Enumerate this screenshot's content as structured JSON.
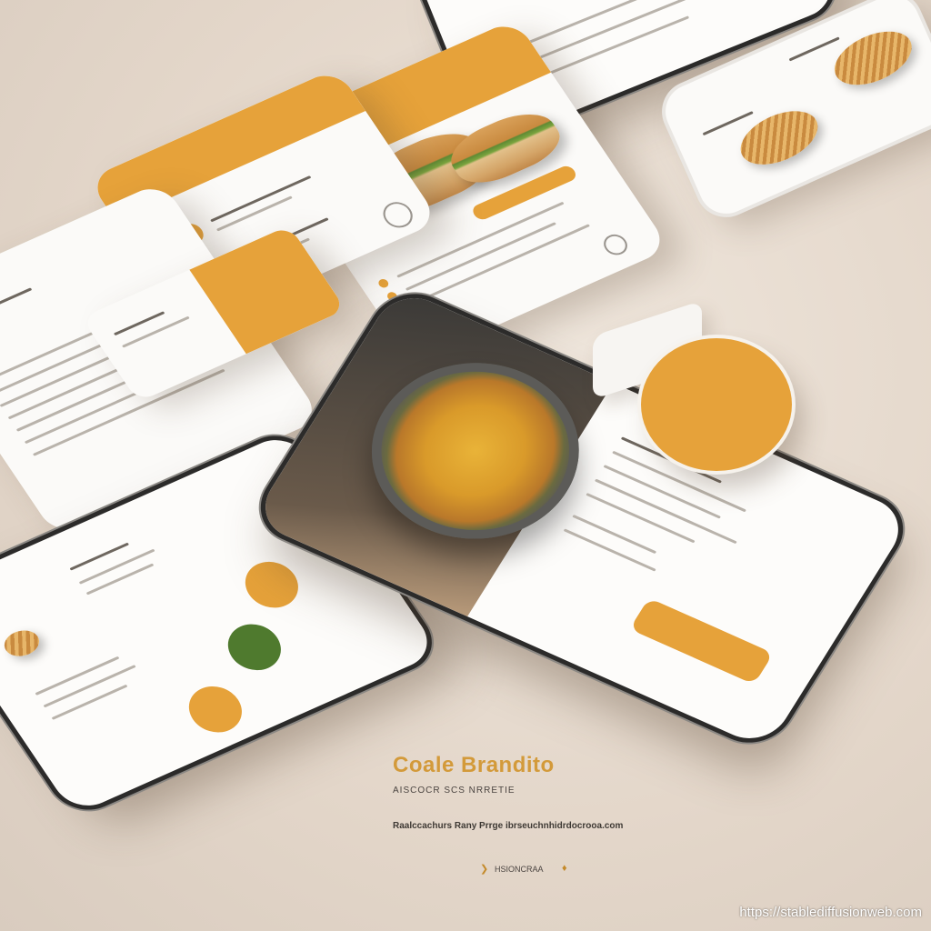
{
  "brand": {
    "title": "Coale Brandito",
    "subtitle": "AISCOCR SCS NRRETIE",
    "tagline": "Raalccachurs Rany Prrge ibrseuchnhidrdocrooa.com",
    "footer": "HSIONCRAA"
  },
  "watermark": "https://stablediffusionweb.com",
  "colors": {
    "accent": "#e6a23a",
    "background": "#e3d6c9",
    "phone_frame": "#2c2b2a"
  },
  "icons": [
    "pan-food-photo",
    "sandwich-photo",
    "pastry-photo",
    "location-pin-icon"
  ]
}
